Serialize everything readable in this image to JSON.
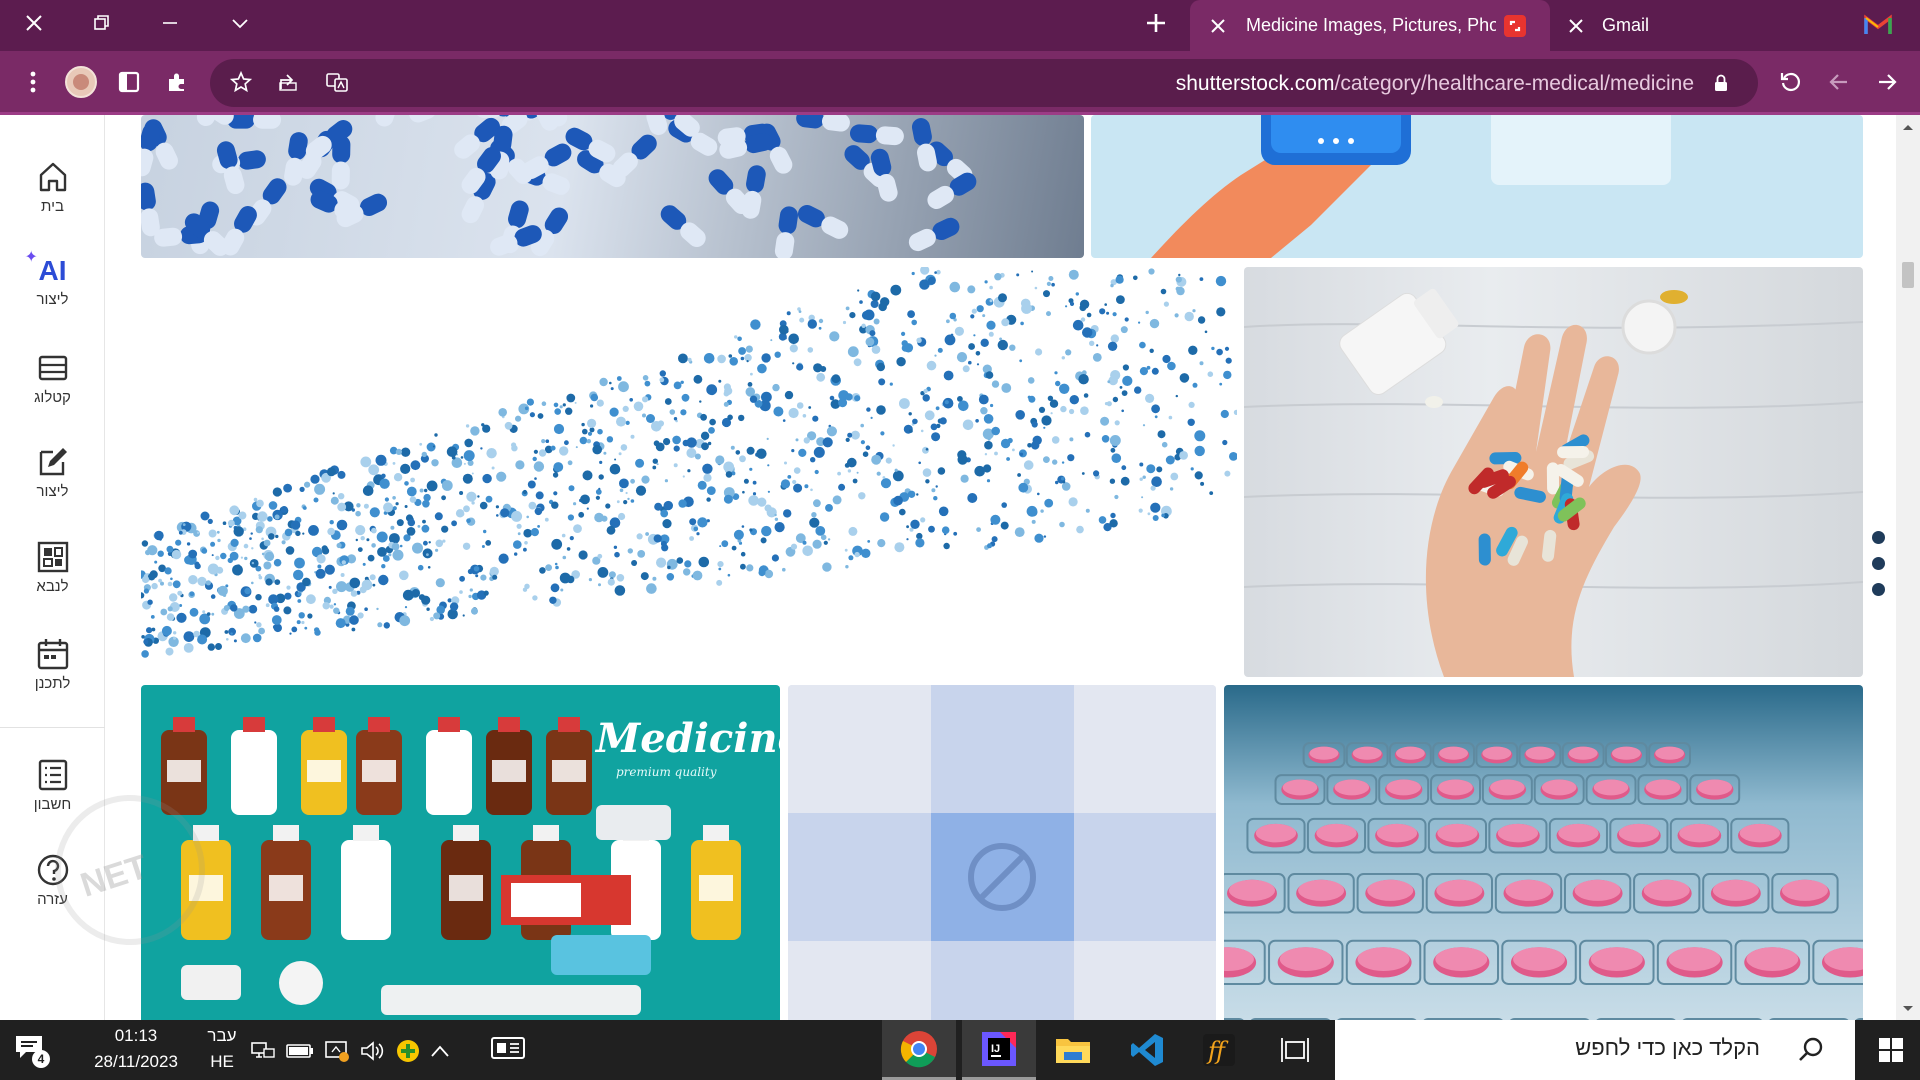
{
  "browser": {
    "tabs": [
      {
        "title": "Medicine Images, Pictures, Photos",
        "active": true,
        "favicon": "shutterstock-icon"
      },
      {
        "title": "Gmail",
        "active": false,
        "favicon": "gmail-icon"
      }
    ],
    "new_tab_icon": "plus-icon",
    "address_bar": {
      "domain": "shutterstock.com",
      "path": "/category/healthcare-medical/medicine"
    },
    "colors": {
      "frame": "#5c1c4f",
      "toolbar": "#7a2a66",
      "omnibox": "#5a1d4c"
    }
  },
  "sidebar": {
    "items": [
      {
        "label": "בית",
        "icon": "home-icon"
      },
      {
        "label": "ליצור",
        "icon": "ai-sparkle-icon",
        "badge": "AI"
      },
      {
        "label": "קטלוג",
        "icon": "catalog-icon"
      },
      {
        "label": "ליצור",
        "icon": "edit-icon"
      },
      {
        "label": "לנבא",
        "icon": "predict-icon"
      },
      {
        "label": "לתכנן",
        "icon": "calendar-icon"
      },
      {
        "label": "חשבון",
        "icon": "account-list-icon"
      },
      {
        "label": "עזרה",
        "icon": "help-icon"
      }
    ]
  },
  "gallery": {
    "images": [
      {
        "subject": "blue-and-white-capsules"
      },
      {
        "subject": "hand-holding-phone-illustration"
      },
      {
        "subject": "blue-dot-particles"
      },
      {
        "subject": "hand-holding-pills"
      },
      {
        "subject": "medicine-flat-illustration",
        "text": "Medicine",
        "subtext": "premium quality"
      },
      {
        "subject": "image-placeholder"
      },
      {
        "subject": "pink-pills-in-blister"
      }
    ]
  },
  "taskbar": {
    "notification_count": "4",
    "time": "01:13",
    "date": "28/11/2023",
    "language_top": "עבר",
    "language_bottom": "HE",
    "search_placeholder": "הקלד כאן כדי לחפש",
    "apps": [
      "chrome-icon",
      "intellij-icon",
      "file-explorer-icon",
      "vscode-icon",
      "fontforge-icon",
      "task-view-icon"
    ]
  }
}
